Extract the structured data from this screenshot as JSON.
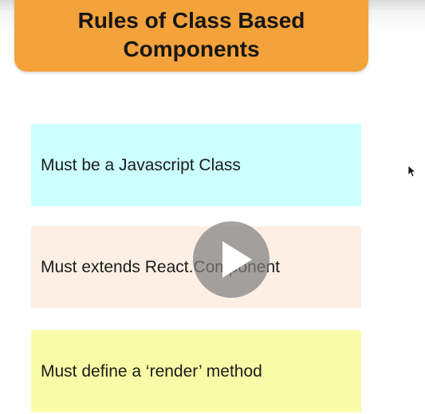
{
  "title": {
    "line1": "Rules of Class Based",
    "line2": "Components"
  },
  "rules": [
    {
      "text": "Must be a Javascript Class",
      "color": "#ccffff"
    },
    {
      "text": "Must extends React.Component",
      "color": "#fdefe4"
    },
    {
      "text": "Must define a ‘render’ method",
      "color": "#f9fca6"
    }
  ],
  "colors": {
    "title_bg": "#f4a23c",
    "play_overlay": "#808080"
  },
  "icons": {
    "play": "play-icon",
    "cursor": "mouse-cursor-icon"
  }
}
